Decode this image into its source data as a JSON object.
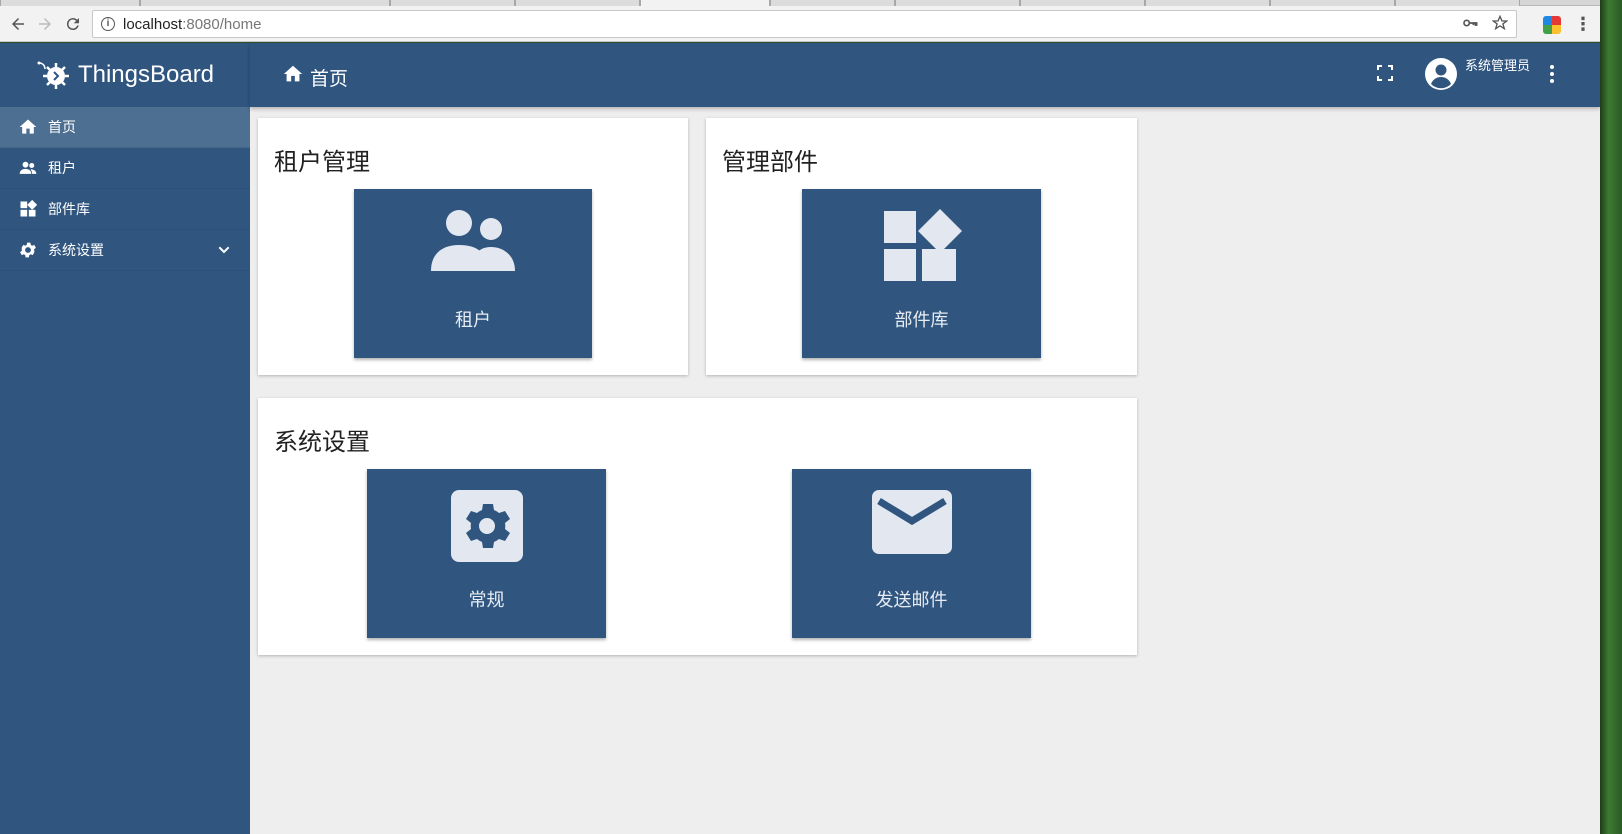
{
  "browser": {
    "url_host": "localhost",
    "url_rest": ":8080/home"
  },
  "app": {
    "logo_text": "ThingsBoard",
    "breadcrumb": "首页",
    "user_name": "系统管理员"
  },
  "sidebar": {
    "items": [
      {
        "label": "首页",
        "icon": "home-icon"
      },
      {
        "label": "租户",
        "icon": "people-icon"
      },
      {
        "label": "部件库",
        "icon": "widgets-icon"
      },
      {
        "label": "系统设置",
        "icon": "gear-icon"
      }
    ]
  },
  "cards": {
    "tenant_mgmt": {
      "title": "租户管理",
      "tile_label": "租户",
      "tile_icon": "people-icon"
    },
    "widget_mgmt": {
      "title": "管理部件",
      "tile_label": "部件库",
      "tile_icon": "widgets-icon"
    },
    "system_settings": {
      "title": "系统设置",
      "tiles": [
        {
          "label": "常规",
          "icon": "settings-icon"
        },
        {
          "label": "发送邮件",
          "icon": "mail-icon"
        }
      ]
    }
  },
  "colors": {
    "primary": "#305680",
    "sidebar_active": "#4d6f92",
    "background": "#eeeeee"
  }
}
